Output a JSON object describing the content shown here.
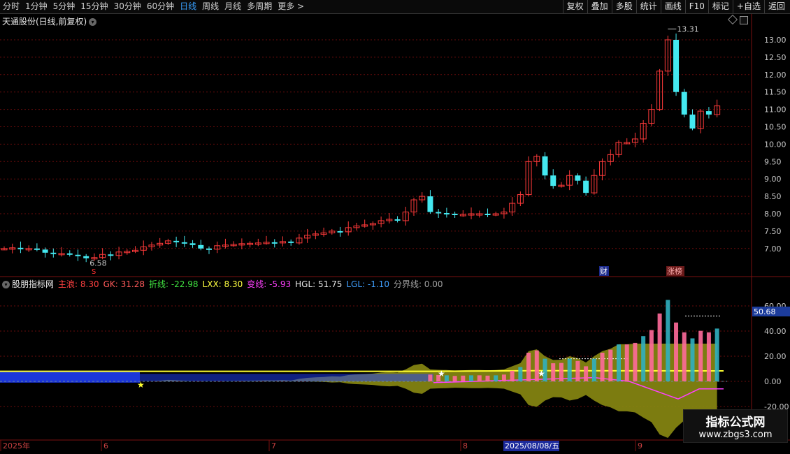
{
  "toolbar": {
    "periods": [
      "分时",
      "1分钟",
      "5分钟",
      "15分钟",
      "30分钟",
      "60分钟",
      "日线",
      "周线",
      "月线",
      "多周期",
      "更多 >"
    ],
    "active_period": "日线",
    "actions": [
      "复权",
      "叠加",
      "多股",
      "统计",
      "画线",
      "F10",
      "标记",
      "+自选",
      "返回"
    ]
  },
  "main_panel": {
    "title": "天通股份(日线,前复权)",
    "price_axis": [
      "13.00",
      "12.50",
      "12.00",
      "11.50",
      "11.00",
      "10.50",
      "10.00",
      "9.50",
      "9.00",
      "8.50",
      "8.00",
      "7.50",
      "7.00"
    ],
    "high_label": "13.31",
    "low_label": "6.58",
    "marker_s": "S",
    "marker_cai": "财",
    "marker_zhangbang": "涨榜"
  },
  "indicator_panel": {
    "name": "股朋指标网",
    "values": [
      {
        "label": "主浪: 8.30",
        "color": "#ff4040"
      },
      {
        "label": "GK: 31.28",
        "color": "#ff5a5a"
      },
      {
        "label": "折线: -22.98",
        "color": "#40e040"
      },
      {
        "label": "LXX: 8.30",
        "color": "#ffff40"
      },
      {
        "label": "变线: -5.93",
        "color": "#ff40ff"
      },
      {
        "label": "HGL: 51.75",
        "color": "#e6e6e6"
      },
      {
        "label": "LGL: -1.10",
        "color": "#40a0ff"
      },
      {
        "label": "分界线: 0.00",
        "color": "#a0a0a0"
      }
    ],
    "axis": [
      "60.00",
      "40.00",
      "20.00",
      "0.00",
      "-20.00"
    ],
    "current_value": "50.68"
  },
  "date_axis": {
    "labels": [
      "2025年",
      "6",
      "7",
      "8",
      "9"
    ],
    "cursor_date": "2025/08/08/五"
  },
  "watermark": {
    "line1": "指标公式网",
    "line2": "www.zbgs3.com"
  },
  "colors": {
    "up": "#ff3a3a",
    "down": "#44e8f0",
    "grid": "#7a1010",
    "indicator_fill": "#8a8a12",
    "blue_band": "#2040ff"
  }
}
